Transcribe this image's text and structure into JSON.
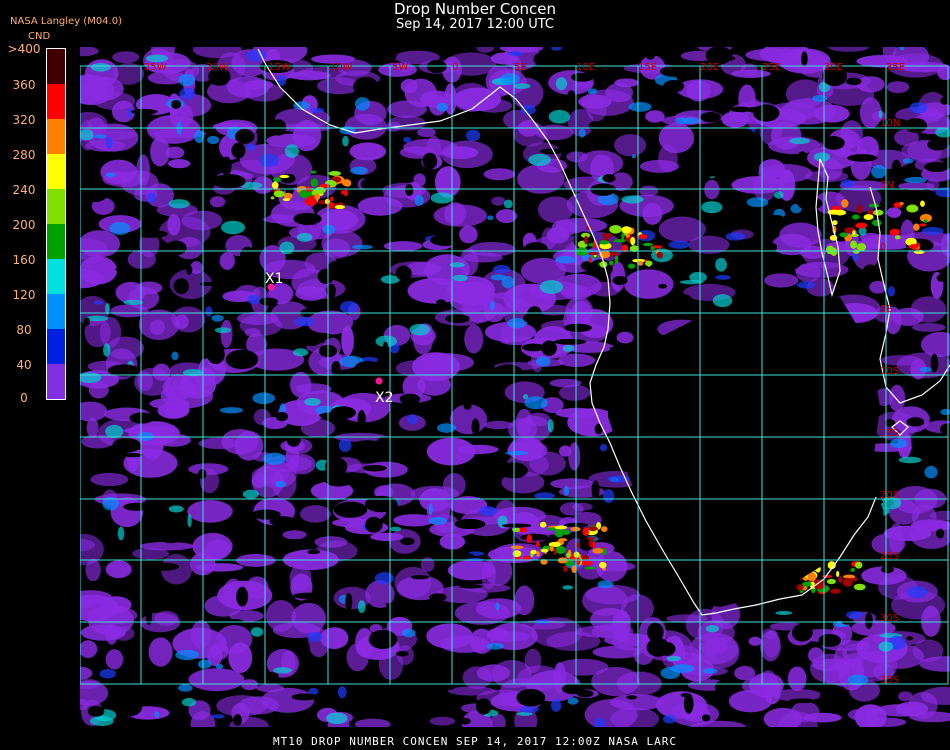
{
  "header": {
    "title": "Drop Number Concen",
    "subtitle": "Sep 14, 2017 12:00 UTC",
    "producer": "NASA Langley (M04.0)",
    "colorbar_unit": "CND"
  },
  "colorbar": {
    "tick_labels": [
      ">400",
      "360",
      "320",
      "280",
      "240",
      "200",
      "160",
      "120",
      "80",
      "40",
      "0"
    ],
    "colors": [
      "#400000",
      "#a00000",
      "#ff0000",
      "#ff8000",
      "#ffff00",
      "#80e000",
      "#00a000",
      "#00e0e0",
      "#0090ff",
      "#0020e0",
      "#8030e0"
    ]
  },
  "map": {
    "background_color": "#000000",
    "cloud_base_color": "#8a2be2",
    "grid_color": "#40e0e0",
    "coastline_color": "#ffffff",
    "label_color": "#c00000",
    "lon_labels": [
      "25W",
      "20W",
      "15W",
      "10W",
      "5W",
      "0",
      "5E",
      "10E",
      "15E",
      "20E",
      "25E",
      "30E",
      "35E"
    ],
    "lat_labels": [
      "10N",
      "5N",
      "0",
      "5S",
      "10S",
      "15S",
      "20S",
      "25S",
      "30S",
      "35S",
      "40S"
    ],
    "markers": [
      {
        "label": "X1"
      },
      {
        "label": "X2"
      }
    ]
  },
  "footer": {
    "text": "MT10  DROP NUMBER CONCEN   SEP 14, 2017 12:00Z   NASA LARC"
  }
}
